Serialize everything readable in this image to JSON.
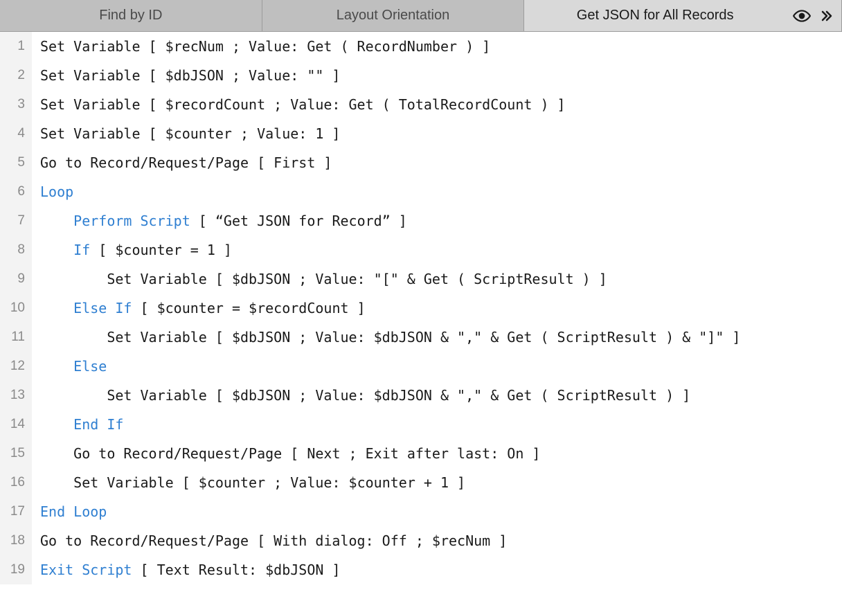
{
  "tabs": [
    {
      "label": "Find by ID",
      "active": false
    },
    {
      "label": "Layout Orientation",
      "active": false
    },
    {
      "label": "Get JSON for All Records",
      "active": true
    }
  ],
  "script_lines": [
    {
      "n": 1,
      "indent": 0,
      "segments": [
        {
          "t": "Set Variable [ $recNum ; Value: Get ( RecordNumber ) ]"
        }
      ]
    },
    {
      "n": 2,
      "indent": 0,
      "segments": [
        {
          "t": "Set Variable [ $dbJSON ; Value: \"\" ]"
        }
      ]
    },
    {
      "n": 3,
      "indent": 0,
      "segments": [
        {
          "t": "Set Variable [ $recordCount ; Value: Get ( TotalRecordCount ) ]"
        }
      ]
    },
    {
      "n": 4,
      "indent": 0,
      "segments": [
        {
          "t": "Set Variable [ $counter ; Value: 1 ]"
        }
      ]
    },
    {
      "n": 5,
      "indent": 0,
      "segments": [
        {
          "t": "Go to Record/Request/Page [ First ]"
        }
      ]
    },
    {
      "n": 6,
      "indent": 0,
      "segments": [
        {
          "t": "Loop",
          "kw": true
        }
      ]
    },
    {
      "n": 7,
      "indent": 1,
      "segments": [
        {
          "t": "Perform Script",
          "kw": true
        },
        {
          "t": " [ “Get JSON for Record” ]"
        }
      ]
    },
    {
      "n": 8,
      "indent": 1,
      "segments": [
        {
          "t": "If",
          "kw": true
        },
        {
          "t": " [ $counter = 1 ]"
        }
      ]
    },
    {
      "n": 9,
      "indent": 2,
      "segments": [
        {
          "t": "Set Variable [ $dbJSON ; Value: \"[\" & Get ( ScriptResult ) ]"
        }
      ]
    },
    {
      "n": 10,
      "indent": 1,
      "segments": [
        {
          "t": "Else If",
          "kw": true
        },
        {
          "t": " [ $counter = $recordCount ]"
        }
      ]
    },
    {
      "n": 11,
      "indent": 2,
      "segments": [
        {
          "t": "Set Variable [ $dbJSON ; Value: $dbJSON & \",\" & Get ( ScriptResult ) & \"]\" ]"
        }
      ]
    },
    {
      "n": 12,
      "indent": 1,
      "segments": [
        {
          "t": "Else",
          "kw": true
        }
      ]
    },
    {
      "n": 13,
      "indent": 2,
      "segments": [
        {
          "t": "Set Variable [ $dbJSON ; Value: $dbJSON & \",\" & Get ( ScriptResult ) ]"
        }
      ]
    },
    {
      "n": 14,
      "indent": 1,
      "segments": [
        {
          "t": "End If",
          "kw": true
        }
      ]
    },
    {
      "n": 15,
      "indent": 1,
      "segments": [
        {
          "t": "Go to Record/Request/Page [ Next ; Exit after last: On ]"
        }
      ]
    },
    {
      "n": 16,
      "indent": 1,
      "segments": [
        {
          "t": "Set Variable [ $counter ; Value: $counter + 1 ]"
        }
      ]
    },
    {
      "n": 17,
      "indent": 0,
      "segments": [
        {
          "t": "End Loop",
          "kw": true
        }
      ]
    },
    {
      "n": 18,
      "indent": 0,
      "segments": [
        {
          "t": "Go to Record/Request/Page [ With dialog: Off ; $recNum ]"
        }
      ]
    },
    {
      "n": 19,
      "indent": 0,
      "segments": [
        {
          "t": "Exit Script",
          "kw": true
        },
        {
          "t": " [ Text Result: $dbJSON ]"
        }
      ]
    }
  ]
}
